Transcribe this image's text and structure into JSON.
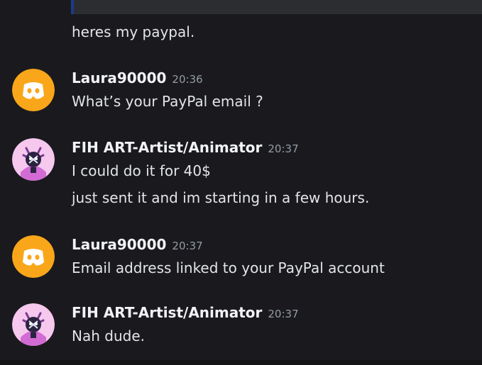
{
  "icons": {
    "discord_avatar": "discord-logo-icon",
    "artist_avatar": "artist-character-avatar"
  },
  "colors": {
    "discord_avatar_bg": "#f9a61a",
    "artist_avatar_bg": "#f6c8ee",
    "background": "#1a1a1e"
  },
  "continuation": {
    "text": "heres my paypal."
  },
  "messages": [
    {
      "author": "Laura90000",
      "time": "20:36",
      "lines": [
        "What’s your PayPal email ?"
      ]
    },
    {
      "author": "FIH ART-Artist/Animator",
      "time": "20:37",
      "lines": [
        "I could do it for 40$",
        "just sent it and im starting in a few hours."
      ]
    },
    {
      "author": "Laura90000",
      "time": "20:37",
      "lines": [
        "Email address linked to your PayPal account"
      ]
    },
    {
      "author": "FIH ART-Artist/Animator",
      "time": "20:37",
      "lines": [
        "Nah dude."
      ]
    }
  ]
}
